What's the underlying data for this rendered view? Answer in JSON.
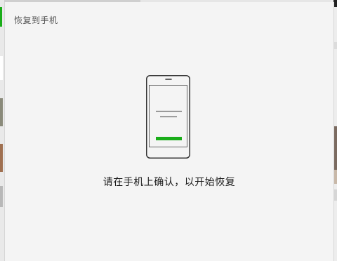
{
  "dialog": {
    "title": "恢复到手机",
    "message": "请在手机上确认，以开始恢复"
  },
  "colors": {
    "accent": "#1aad19",
    "background": "#f4f4f4",
    "phone_outline": "#333333"
  },
  "icons": {
    "phone": "phone-confirm-icon"
  }
}
